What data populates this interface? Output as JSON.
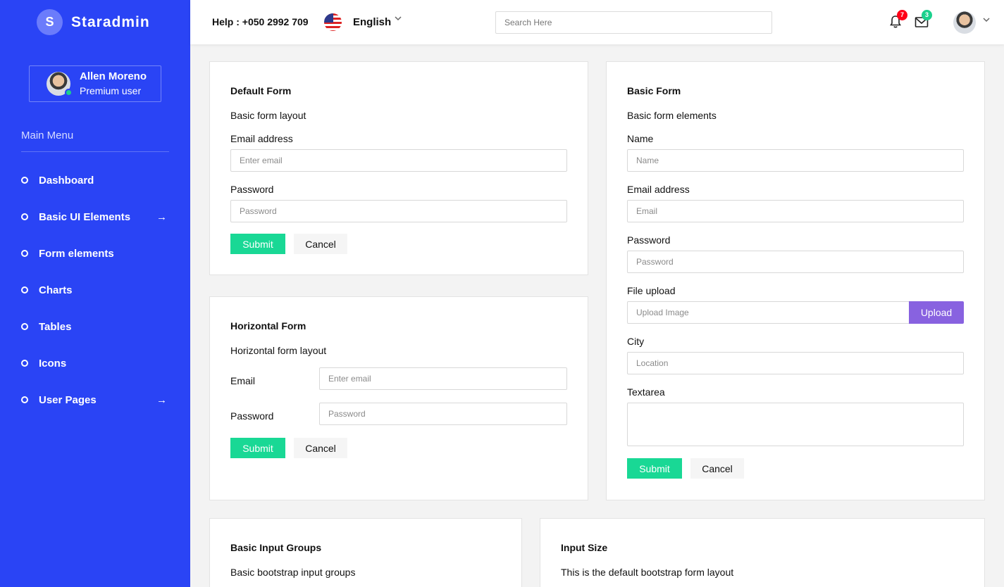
{
  "brand": {
    "letter": "S",
    "name": "Staradmin"
  },
  "profile": {
    "name": "Allen Moreno",
    "role": "Premium user"
  },
  "sidebar": {
    "menu_title": "Main Menu",
    "items": [
      {
        "label": "Dashboard",
        "arrow": ""
      },
      {
        "label": "Basic UI Elements",
        "arrow": "→"
      },
      {
        "label": "Form elements",
        "arrow": ""
      },
      {
        "label": "Charts",
        "arrow": ""
      },
      {
        "label": "Tables",
        "arrow": ""
      },
      {
        "label": "Icons",
        "arrow": ""
      },
      {
        "label": "User Pages",
        "arrow": "→"
      }
    ]
  },
  "topbar": {
    "help": "Help : +050 2992 709",
    "language": "English",
    "search_placeholder": "Search Here",
    "notifications_count": "7",
    "messages_count": "3"
  },
  "default_form": {
    "title": "Default Form",
    "description": "Basic form layout",
    "email_label": "Email address",
    "email_placeholder": "Enter email",
    "password_label": "Password",
    "password_placeholder": "Password",
    "submit": "Submit",
    "cancel": "Cancel"
  },
  "horizontal_form": {
    "title": "Horizontal Form",
    "description": "Horizontal form layout",
    "email_label": "Email",
    "email_placeholder": "Enter email",
    "password_label": "Password",
    "password_placeholder": "Password",
    "submit": "Submit",
    "cancel": "Cancel"
  },
  "basic_form": {
    "title": "Basic Form",
    "description": "Basic form elements",
    "name_label": "Name",
    "name_placeholder": "Name",
    "email_label": "Email address",
    "email_placeholder": "Email",
    "password_label": "Password",
    "password_placeholder": "Password",
    "file_label": "File upload",
    "file_placeholder": "Upload Image",
    "upload": "Upload",
    "city_label": "City",
    "city_placeholder": "Location",
    "textarea_label": "Textarea",
    "submit": "Submit",
    "cancel": "Cancel"
  },
  "input_groups": {
    "title": "Basic Input Groups",
    "description": "Basic bootstrap input groups"
  },
  "input_size": {
    "title": "Input Size",
    "description": "This is the default bootstrap form layout"
  },
  "colors": {
    "sidebar": "#2a44f5",
    "success": "#19d895",
    "upload": "#8862e0",
    "danger": "#ff0017"
  }
}
